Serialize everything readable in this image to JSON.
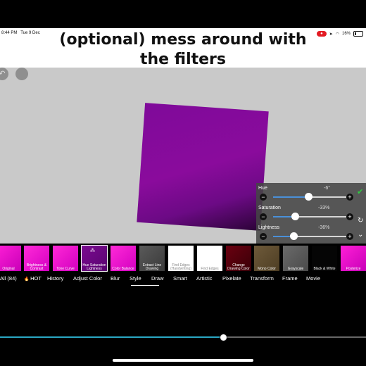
{
  "status": {
    "time": "8:44 PM",
    "date": "Tue 9 Dec",
    "battery": "16%"
  },
  "caption": {
    "line1": "(optional) mess around with",
    "line2": "the filters"
  },
  "adjust_panel": {
    "sliders": [
      {
        "label": "Hue",
        "value_text": "-6°",
        "value": -6
      },
      {
        "label": "Saturation",
        "value_text": "-33%",
        "value": -33
      },
      {
        "label": "Lightness",
        "value_text": "-36%",
        "value": -36
      }
    ]
  },
  "filters": [
    {
      "label": "Original",
      "bg": "linear-gradient(135deg,#ff1fd6,#c800b8)"
    },
    {
      "label": "Brightness & Contrast",
      "bg": "linear-gradient(135deg,#ff2ad8,#d400c2)"
    },
    {
      "label": "Tone Curve",
      "bg": "linear-gradient(135deg,#ff28d6,#d200c0)"
    },
    {
      "label": "Hue Saturation Lightness",
      "bg": "linear-gradient(135deg,#7a0a90,#5a0570)"
    },
    {
      "label": "Color Balance",
      "bg": "linear-gradient(135deg,#ff2ad8,#d300c0)"
    },
    {
      "label": "Extract Line Drawing",
      "bg": "linear-gradient(135deg,#5a5a5a,#3a3a3a)"
    },
    {
      "label": "Find Edges (Handwriting)",
      "bg": "#ffffff"
    },
    {
      "label": "Find Edges",
      "bg": "#ffffff"
    },
    {
      "label": "Change Drawing Color",
      "bg": "linear-gradient(135deg,#6a0010,#3a0008)"
    },
    {
      "label": "Mono Color",
      "bg": "linear-gradient(135deg,#6e5a3a,#4e3e24)"
    },
    {
      "label": "Grayscale",
      "bg": "linear-gradient(135deg,#6a6a6a,#4a4a4a)"
    },
    {
      "label": "Black & White",
      "bg": "#050505"
    },
    {
      "label": "Posterize",
      "bg": "linear-gradient(135deg,#ff1fd6,#c800b8)"
    }
  ],
  "tabs": [
    {
      "label": "All (84)"
    },
    {
      "label": "HOT"
    },
    {
      "label": "History"
    },
    {
      "label": "Adjust Color"
    },
    {
      "label": "Blur"
    },
    {
      "label": "Style"
    },
    {
      "label": "Draw"
    },
    {
      "label": "Smart"
    },
    {
      "label": "Artistic"
    },
    {
      "label": "Pixelate"
    },
    {
      "label": "Transform"
    },
    {
      "label": "Frame"
    },
    {
      "label": "Movie"
    }
  ],
  "scrubber": {
    "progress": 0.61
  }
}
